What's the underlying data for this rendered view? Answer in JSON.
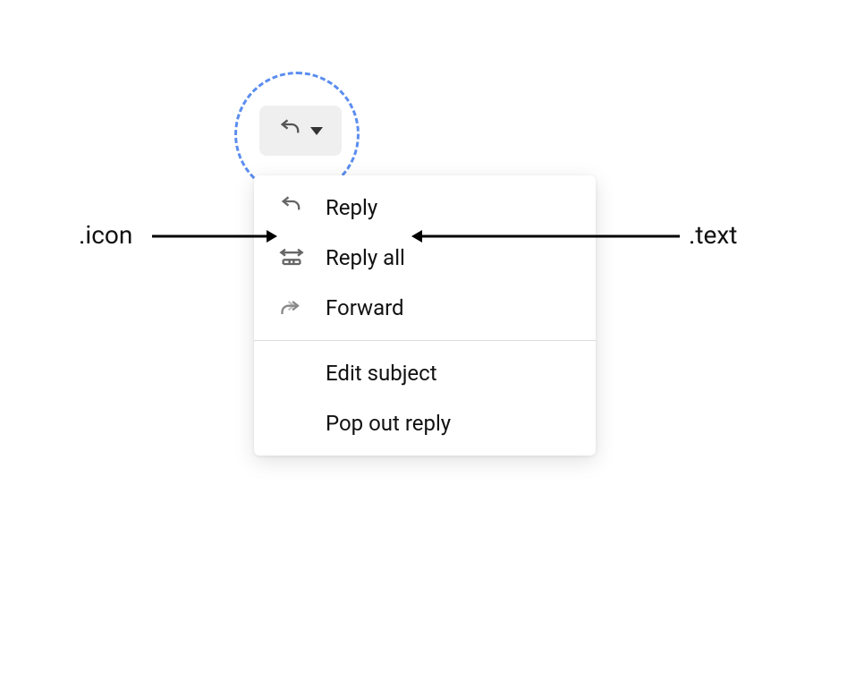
{
  "dropdown": {
    "button_icon": "reply-icon",
    "caret_icon": "caret-down-icon"
  },
  "menu": {
    "items": [
      {
        "icon": "reply-icon",
        "label": "Reply"
      },
      {
        "icon": "reply-all-icon",
        "label": "Reply all"
      },
      {
        "icon": "forward-icon",
        "label": "Forward"
      }
    ],
    "items2": [
      {
        "label": "Edit subject"
      },
      {
        "label": "Pop out reply"
      }
    ]
  },
  "annotations": {
    "icon_label": ".icon",
    "text_label": ".text"
  }
}
